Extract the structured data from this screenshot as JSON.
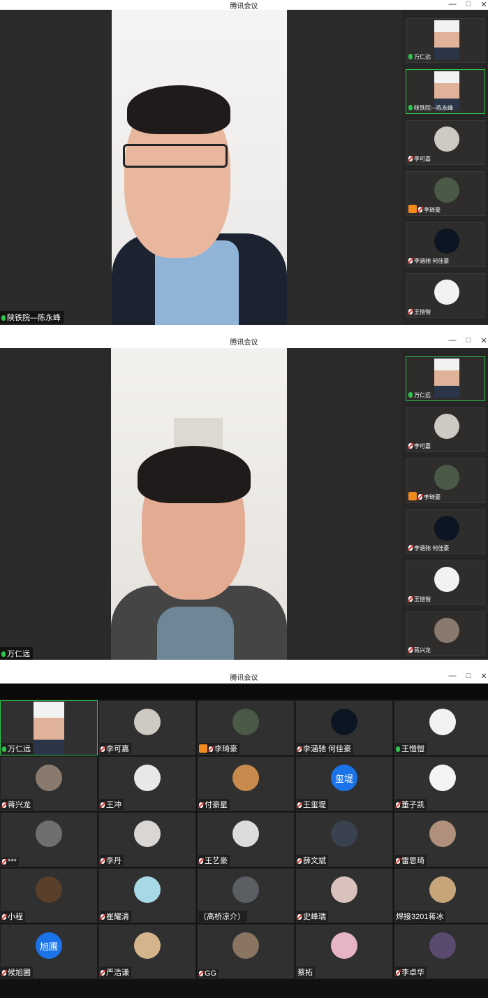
{
  "app_title": "腾讯会议",
  "window_controls": {
    "minimize": "—",
    "maximize": "□",
    "close": "✕"
  },
  "panels": [
    {
      "main_speaker": "陕铁院—陈永峰",
      "main_mic": "on",
      "thumbnails": [
        {
          "name": "万仁远",
          "mic": "on",
          "kind": "video"
        },
        {
          "name": "陕铁院—陈永峰",
          "mic": "on",
          "kind": "video",
          "active": true
        },
        {
          "name": "李可嘉",
          "mic": "off",
          "kind": "avatar",
          "color": "#cfc9c4"
        },
        {
          "name": "李琦豪",
          "mic": "off",
          "kind": "avatar",
          "color": "#4a5a46",
          "badge": true
        },
        {
          "name": "李涵驰  何佳豪",
          "mic": "off",
          "kind": "avatar",
          "color": "#0c1622"
        },
        {
          "name": "王愷愷",
          "mic": "off",
          "kind": "avatar",
          "color": "#f2f2f2"
        }
      ]
    },
    {
      "main_speaker": "万仁远",
      "main_mic": "on",
      "thumbnails": [
        {
          "name": "万仁远",
          "mic": "on",
          "kind": "video",
          "active": true
        },
        {
          "name": "李可嘉",
          "mic": "off",
          "kind": "avatar",
          "color": "#cfc9c4"
        },
        {
          "name": "李琦豪",
          "mic": "off",
          "kind": "avatar",
          "color": "#4a5a46",
          "badge": true
        },
        {
          "name": "李涵驰  何佳豪",
          "mic": "off",
          "kind": "avatar",
          "color": "#0c1622"
        },
        {
          "name": "王愷愷",
          "mic": "off",
          "kind": "avatar",
          "color": "#f2f2f2"
        },
        {
          "name": "蒋兴龙",
          "mic": "off",
          "kind": "avatar",
          "color": "#8a7a6e"
        }
      ]
    }
  ],
  "gallery": [
    {
      "name": "万仁远",
      "mic": "on",
      "kind": "video",
      "active": true
    },
    {
      "name": "李可嘉",
      "mic": "off",
      "color": "#cfc9c4"
    },
    {
      "name": "李琦豪",
      "mic": "off",
      "color": "#4a5a46",
      "badge": true
    },
    {
      "name": "李涵驰  何佳豪",
      "mic": "off",
      "color": "#0c1622"
    },
    {
      "name": "王愷愷",
      "mic": "on",
      "color": "#f2f2f2"
    },
    {
      "name": "蒋兴龙",
      "mic": "off",
      "color": "#8a7a6e"
    },
    {
      "name": "王冲",
      "mic": "off",
      "color": "#e8e8e8"
    },
    {
      "name": "付豪星",
      "mic": "off",
      "color": "#c98a4e"
    },
    {
      "name": "王玺堤",
      "mic": "off",
      "color": "#1a73e8",
      "initials": "玺堤"
    },
    {
      "name": "董子凯",
      "mic": "off",
      "color": "#f4f4f4"
    },
    {
      "name": "***",
      "mic": "off",
      "color": "#6f6f6f"
    },
    {
      "name": "李丹",
      "mic": "off",
      "color": "#d9d6d3"
    },
    {
      "name": "王艺豪",
      "mic": "off",
      "color": "#dcdcdc"
    },
    {
      "name": "薛文斌",
      "mic": "off",
      "color": "#3a4250"
    },
    {
      "name": "雷思琦",
      "mic": "off",
      "color": "#b08f7c"
    },
    {
      "name": "小程",
      "mic": "off",
      "color": "#5a3f2a"
    },
    {
      "name": "崔耀清",
      "mic": "off",
      "color": "#a6d8e6"
    },
    {
      "name": "（高桥凉介）",
      "mic": "none",
      "color": "#5b5e63"
    },
    {
      "name": "史峰瑞",
      "mic": "off",
      "color": "#d8c2bb"
    },
    {
      "name": "焊接3201蒋冰",
      "mic": "none",
      "color": "#c8a47a"
    },
    {
      "name": "候旭圃",
      "mic": "off",
      "color": "#1a73e8",
      "initials": "旭圃"
    },
    {
      "name": "严浩谦",
      "mic": "off",
      "color": "#d4b48d"
    },
    {
      "name": "GG",
      "mic": "off",
      "color": "#8a7563"
    },
    {
      "name": "蔡拓",
      "mic": "none",
      "color": "#e7b3c6"
    },
    {
      "name": "李卓华",
      "mic": "off",
      "color": "#5a4a6e"
    }
  ]
}
